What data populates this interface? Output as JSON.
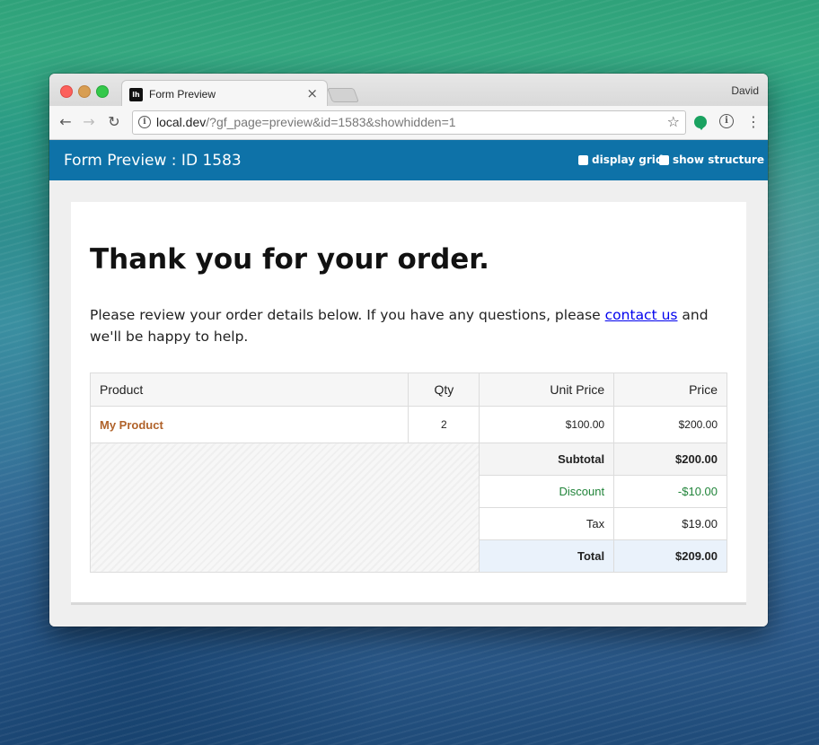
{
  "browser": {
    "tab_title": "Form Preview",
    "tab_favicon": "lh",
    "tab_close": "×",
    "profile_name": "David",
    "url_host": "local.dev",
    "url_path": "/?gf_page=preview&id=1583&showhidden=1",
    "nav": {
      "back": "←",
      "forward": "→",
      "reload": "↻",
      "star": "☆",
      "menu": "⋮",
      "info": "i"
    }
  },
  "header": {
    "title": "Form Preview : ID 1583",
    "options": [
      {
        "label": "display grid",
        "checked": false
      },
      {
        "label": "show structure",
        "checked": false
      }
    ]
  },
  "confirmation": {
    "heading": "Thank you for your order.",
    "intro_before": "Please review your order details below. If you have any questions, please ",
    "intro_link": "contact us",
    "intro_after": " and we'll be happy to help."
  },
  "order_table": {
    "columns": [
      "Product",
      "Qty",
      "Unit Price",
      "Price"
    ],
    "items": [
      {
        "product": "My Product",
        "qty": "2",
        "unit_price": "$100.00",
        "price": "$200.00"
      }
    ],
    "summary": {
      "subtotal_label": "Subtotal",
      "subtotal": "$200.00",
      "discount_label": "Discount",
      "discount": "-$10.00",
      "tax_label": "Tax",
      "tax": "$19.00",
      "total_label": "Total",
      "total": "$209.00"
    }
  },
  "colors": {
    "header_bar": "#0e72a8",
    "product_link": "#b0622a",
    "discount_green": "#21843a",
    "total_row_bg": "#eaf2fb"
  }
}
